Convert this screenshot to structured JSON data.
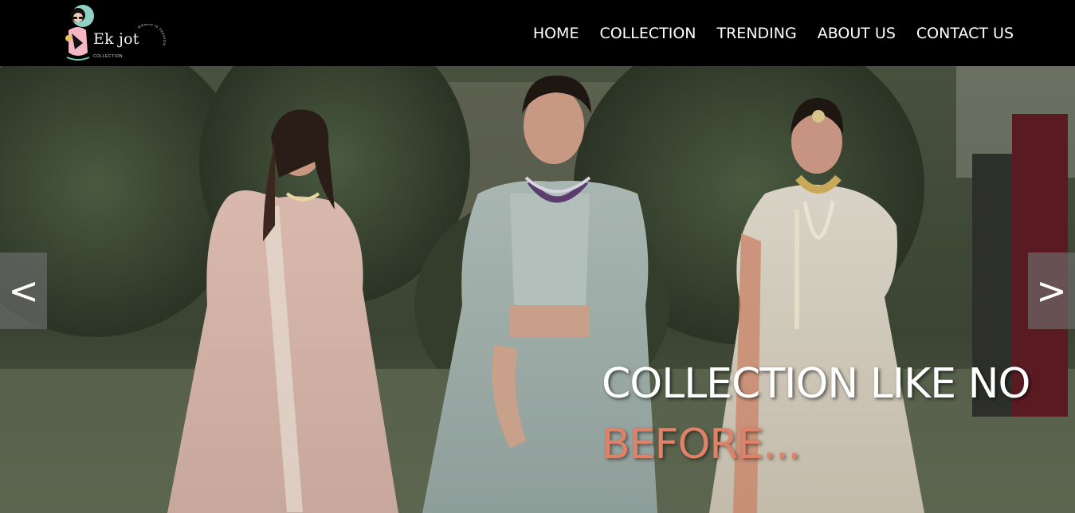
{
  "header": {
    "logo": {
      "name": "Ek jot",
      "subtitle": "COLLECTION",
      "arc_text": "WOMAN IS FASHION"
    },
    "nav": [
      {
        "label": "HOME"
      },
      {
        "label": "COLLECTION"
      },
      {
        "label": "TRENDING"
      },
      {
        "label": "ABOUT US"
      },
      {
        "label": "CONTACT US"
      }
    ]
  },
  "hero": {
    "prev_label": "<",
    "next_label": ">",
    "caption_line1": "COLLECTION LIKE NO",
    "caption_line2": "BEFORE...",
    "image_description_icon": "bridal-lehenga-photo"
  },
  "colors": {
    "header_bg": "#000000",
    "nav_text": "#ffffff",
    "caption_primary": "#ffffff",
    "caption_accent": "#e0826a",
    "slider_button_bg": "#6e6e6e"
  }
}
